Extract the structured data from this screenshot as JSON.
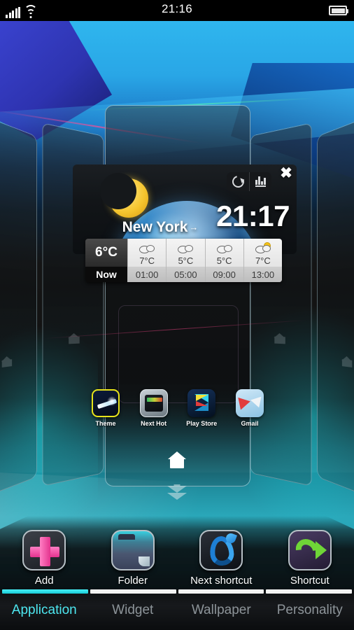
{
  "statusbar": {
    "time": "21:16",
    "signal_icon": "signal-bars-icon",
    "wifi_icon": "wifi-icon",
    "battery_icon": "battery-icon"
  },
  "widget": {
    "city": "New York",
    "city_arrow": "→",
    "clock": "21:17",
    "moon_icon": "crescent-moon-icon",
    "earth_icon": "earth-globe-icon",
    "refresh_icon": "refresh-icon",
    "chart_icon": "bar-chart-icon",
    "close_icon": "✖",
    "current": {
      "temp": "6°C",
      "label": "Now"
    },
    "forecast": [
      {
        "icon": "cloudy-icon",
        "temp": "7°C",
        "time": "01:00"
      },
      {
        "icon": "cloudy-icon",
        "temp": "5°C",
        "time": "05:00"
      },
      {
        "icon": "cloudy-icon",
        "temp": "5°C",
        "time": "09:00"
      },
      {
        "icon": "sun-behind-cloud-icon",
        "temp": "7°C",
        "time": "13:00"
      }
    ]
  },
  "apps": [
    {
      "label": "Theme",
      "icon": "theme-app-icon"
    },
    {
      "label": "Next Hot",
      "icon": "next-hot-app-icon"
    },
    {
      "label": "Play Store",
      "icon": "play-store-app-icon"
    },
    {
      "label": "Gmail",
      "icon": "gmail-app-icon"
    }
  ],
  "home_button": {
    "icon": "home-icon"
  },
  "drawer_handle": {
    "icon": "double-down-arrow-icon"
  },
  "dock": [
    {
      "label": "Add",
      "icon": "plus-icon"
    },
    {
      "label": "Folder",
      "icon": "folder-icon"
    },
    {
      "label": "Next shortcut",
      "icon": "next-swoosh-icon"
    },
    {
      "label": "Shortcut",
      "icon": "green-arrow-icon"
    }
  ],
  "tabs": [
    {
      "label": "Application",
      "active": true
    },
    {
      "label": "Widget",
      "active": false
    },
    {
      "label": "Wallpaper",
      "active": false
    },
    {
      "label": "Personality",
      "active": false
    }
  ],
  "colors": {
    "accent_cyan": "#4de7f0",
    "tab_bar_active": "#17cbd6",
    "tab_bar_inactive": "#f2f2f2",
    "add_pink": "#e4338e",
    "shortcut_green": "#6fd637",
    "next_blue": "#1e7fd4",
    "wallpaper_top": "#2fb6ee",
    "wallpaper_floor": "#2aa8ba"
  }
}
